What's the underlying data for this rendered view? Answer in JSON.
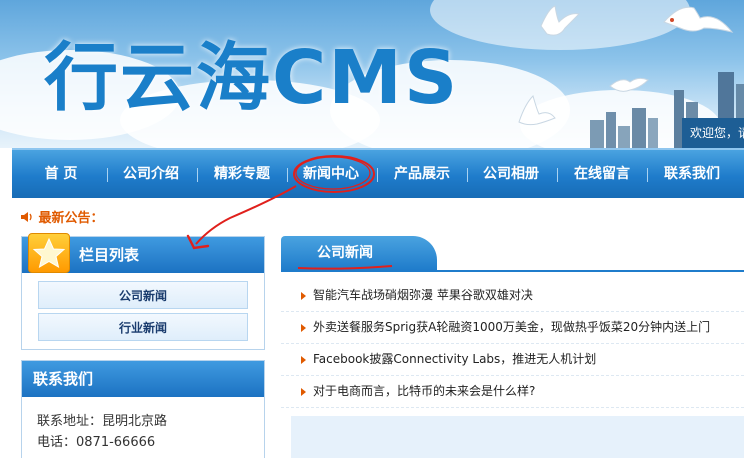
{
  "banner": {
    "logo_text": "行云海CMS",
    "welcome_text": "欢迎您，请"
  },
  "nav": {
    "items": [
      {
        "label": "首 页"
      },
      {
        "label": "公司介绍"
      },
      {
        "label": "精彩专题"
      },
      {
        "label": "新闻中心"
      },
      {
        "label": "产品展示"
      },
      {
        "label": "公司相册"
      },
      {
        "label": "在线留言"
      },
      {
        "label": "联系我们"
      }
    ]
  },
  "notice": {
    "label": "最新公告："
  },
  "sidebar": {
    "categories_title": "栏目列表",
    "categories": [
      {
        "label": "公司新闻"
      },
      {
        "label": "行业新闻"
      }
    ],
    "contact_title": "联系我们",
    "contact_lines": [
      {
        "text": "联系地址：昆明北京路"
      },
      {
        "text": "电话：0871-66666"
      }
    ]
  },
  "news": {
    "tab_label": "公司新闻",
    "items": [
      {
        "title": "智能汽车战场硝烟弥漫 苹果谷歌双雄对决"
      },
      {
        "title": "外卖送餐服务Sprig获A轮融资1000万美金，现做热乎饭菜20分钟内送上门"
      },
      {
        "title": "Facebook披露Connectivity Labs，推进无人机计划"
      },
      {
        "title": "对于电商而言，比特币的未来会是什么样?"
      }
    ]
  },
  "colors": {
    "nav_blue": "#1f7ccb",
    "notice_orange": "#e05a00",
    "annotation_red": "#e0201c"
  }
}
